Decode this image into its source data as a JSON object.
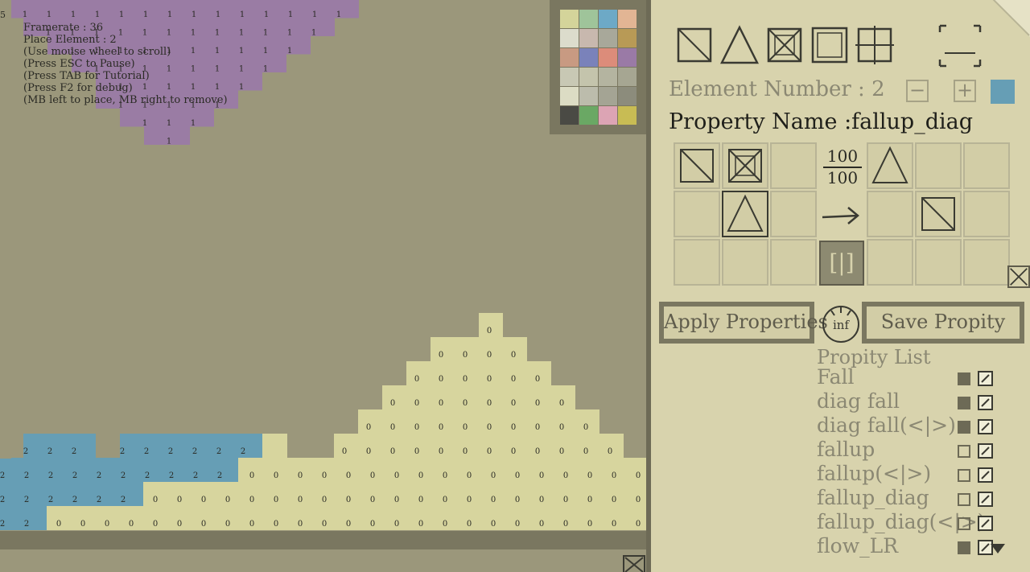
{
  "hud": {
    "corner": "5",
    "lines": [
      "Framerate : 36",
      "Place Element : 2",
      "(Use mouse wheel to scroll)",
      "(Press ESC to Pause)",
      "(Press TAB for Tutorial)",
      "(Press F2 for debug)",
      "(MB left to place, MB right to remove)"
    ]
  },
  "colors": {
    "background": "#9b977b",
    "panel": "#d8d3ad",
    "purple": "#9a7ca4",
    "sand": "#d7d59e",
    "water": "#669eb5",
    "selected_color": "#669eb5"
  },
  "palette": [
    "#d4d49a",
    "#9fc49a",
    "#6da9c6",
    "#e2b594",
    "#dcdccc",
    "#c8b8ae",
    "#a8a89a",
    "#b89a56",
    "#c89a82",
    "#7a82ba",
    "#dc8c7a",
    "#9a7aa6",
    "#c8c8b4",
    "#c4c4ac",
    "#b4b4a0",
    "#a6a692",
    "#dcdcc4",
    "#bcbcac",
    "#a4a494",
    "#8c8c7c",
    "#4a4a44",
    "#6aa864",
    "#dca4b4",
    "#c8bc54"
  ],
  "panel": {
    "tools": [
      "empty-cell-icon",
      "triangle-icon",
      "crossed-cell-icon",
      "double-square-icon",
      "hash-grid-icon"
    ],
    "element_number_label": "Element Number : 2",
    "minus": "−",
    "plus": "+",
    "property_name_label": "Property Name :fallup_diag",
    "probability_top": "100",
    "probability_bottom": "100",
    "mirror_symbol": "[|]",
    "apply_label": "Apply Properties",
    "inf_label": "inf",
    "save_label": "Save Propity",
    "list_title": "Propity List",
    "list": [
      {
        "name": "Fall",
        "checked": true
      },
      {
        "name": "diag fall",
        "checked": true
      },
      {
        "name": "diag fall(<|>)",
        "checked": true
      },
      {
        "name": "fallup",
        "checked": false
      },
      {
        "name": "fallup(<|>)",
        "checked": false
      },
      {
        "name": "fallup_diag",
        "checked": false
      },
      {
        "name": "fallup_diag(<|>)",
        "checked": false
      },
      {
        "name": "flow_LR",
        "checked": true
      }
    ]
  },
  "world": {
    "purple_rows": [
      {
        "from": 0,
        "to": 446
      },
      {
        "from": 29,
        "to": 416
      },
      {
        "from": 59,
        "to": 386
      },
      {
        "from": 89,
        "to": 356
      },
      {
        "from": 119,
        "to": 326
      },
      {
        "from": 119,
        "to": 296
      },
      {
        "from": 149,
        "to": 266
      },
      {
        "from": 179,
        "to": 236
      }
    ],
    "purple_label": "1",
    "sand_label": "0",
    "water_label": "2"
  }
}
